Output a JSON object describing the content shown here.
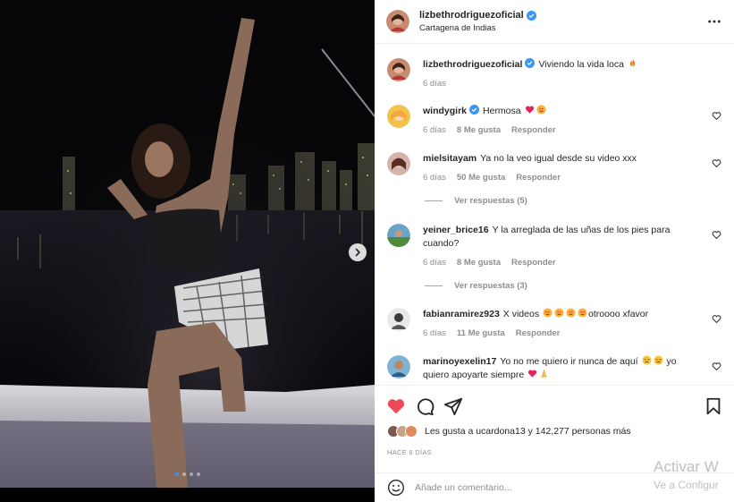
{
  "header": {
    "username": "lizbethrodriguezoficial",
    "location": "Cartagena de Indias"
  },
  "caption": {
    "username": "lizbethrodriguezoficial",
    "text": "Viviendo la vida loca",
    "time": "6 días"
  },
  "comments": [
    {
      "username": "windygirk",
      "text": "Hermosa",
      "time": "6 días",
      "likes": "8 Me gusta",
      "reply": "Responder"
    },
    {
      "username": "mielsitayam",
      "text": "Ya no la veo igual desde su video xxx",
      "time": "6 días",
      "likes": "50 Me gusta",
      "reply": "Responder",
      "view_replies": "Ver respuestas (5)"
    },
    {
      "username": "yeiner_brice16",
      "text": "Y la arreglada de las uñas de los pies para",
      "text2": "cuando?",
      "time": "6 días",
      "likes": "8 Me gusta",
      "reply": "Responder",
      "view_replies": "Ver respuestas (3)"
    },
    {
      "username": "fabianramirez923",
      "text": "X videos",
      "text_tail": "otroooo xfavor",
      "time": "6 días",
      "likes": "11 Me gusta",
      "reply": "Responder"
    },
    {
      "username": "marinoyexelin17",
      "text": "Yo no me quiero ir nunca de aquí",
      "text_tail": "yo",
      "text2": "quiero apoyarte siempre"
    }
  ],
  "likes_summary": "Les gusta a ucardona13 y 142,277 personas más",
  "post_date": "HACE 6 DÍAS",
  "add_comment": {
    "placeholder": "Añade un comentario..."
  },
  "watermark": {
    "line1": "Activar W",
    "line2": "Ve a Configur"
  },
  "colors": {
    "verified": "#3897f0",
    "like_red": "#ed4956",
    "muted": "#8e8e8e"
  },
  "carousel": {
    "slides": 4,
    "active": 1
  }
}
